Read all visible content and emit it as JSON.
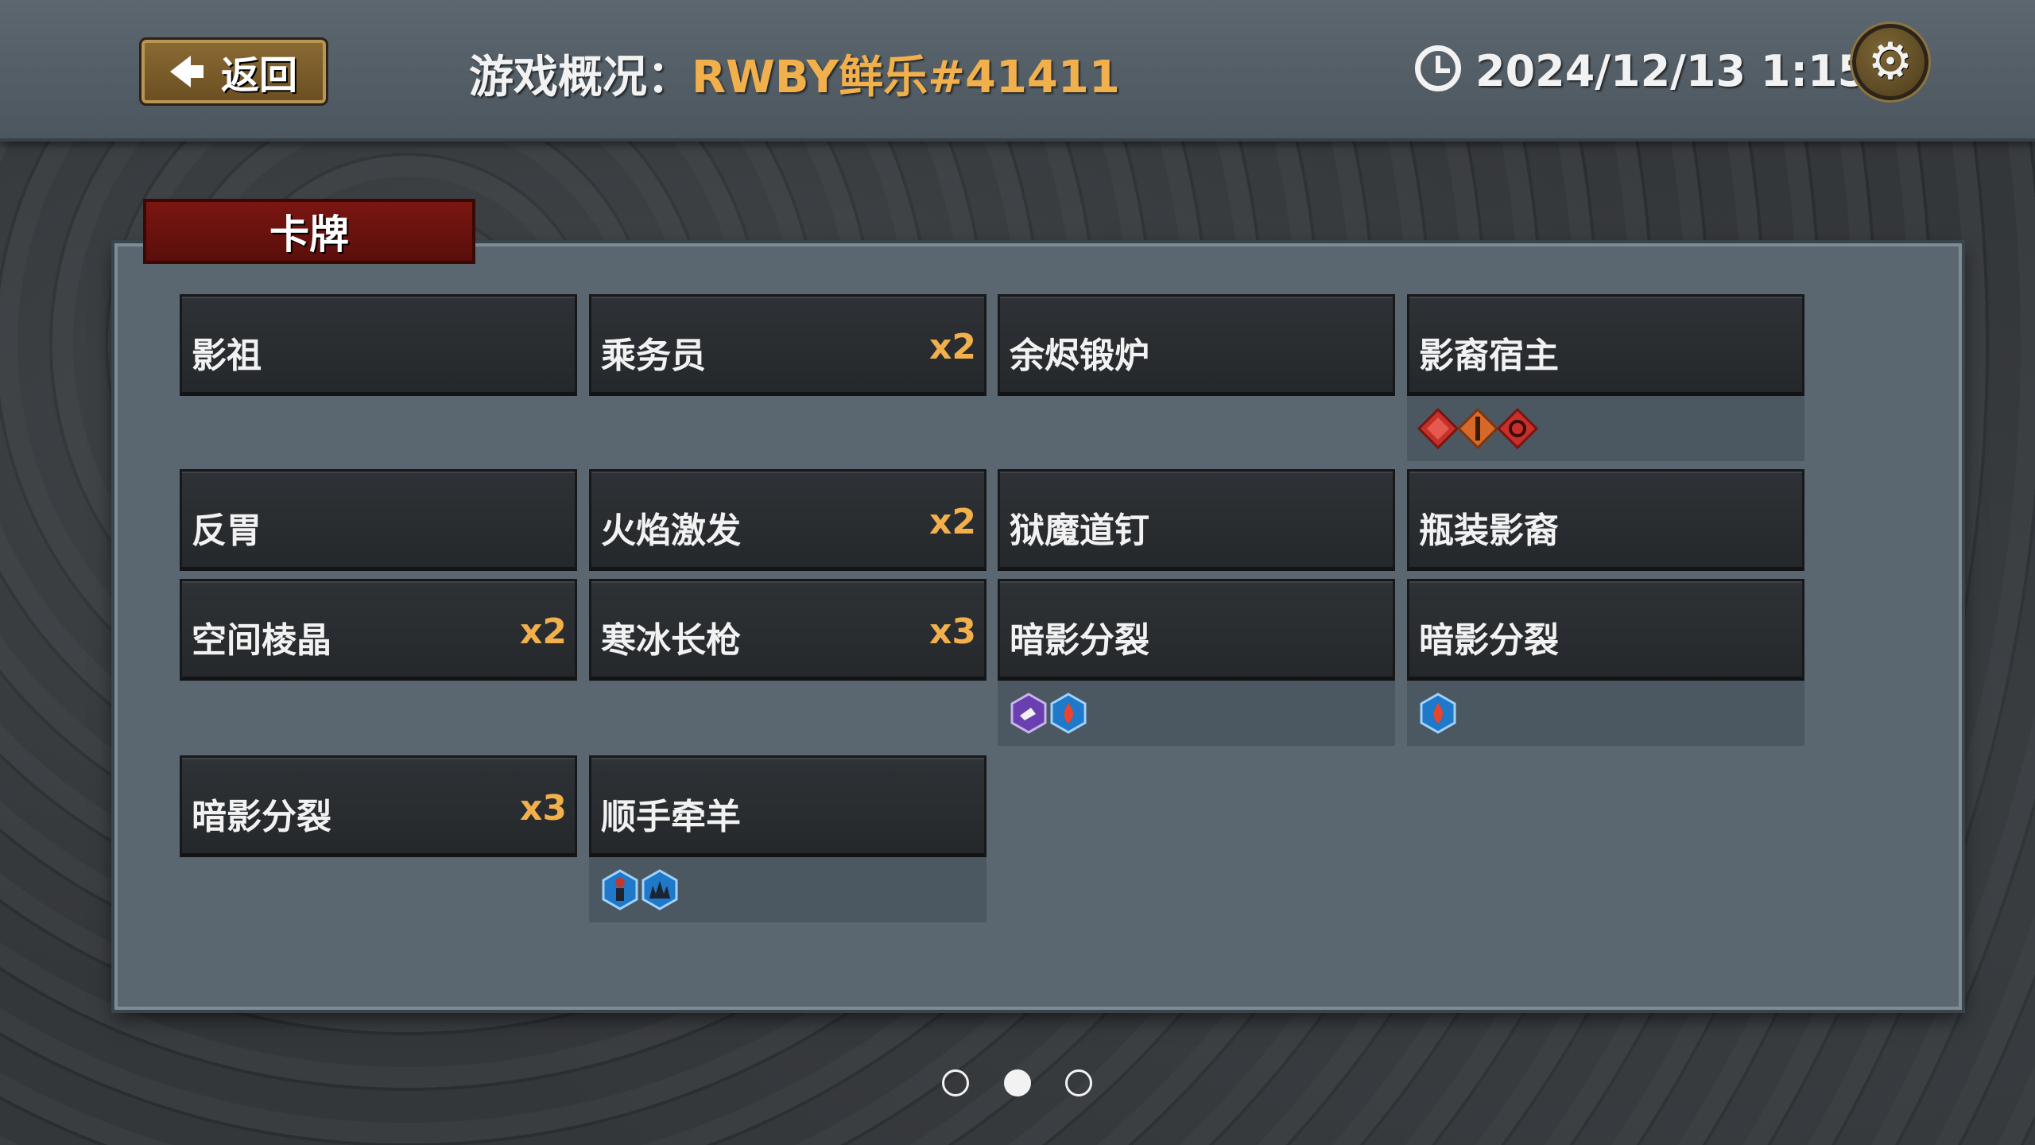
{
  "header": {
    "back_label": "返回",
    "title_prefix": "游戏概况：",
    "game_name": "RWBY鲜乐#41411",
    "datetime": "2024/12/13 1:15"
  },
  "section": {
    "title": "卡牌"
  },
  "cards": [
    {
      "name": "影祖",
      "count": ""
    },
    {
      "name": "乘务员",
      "count": "x2"
    },
    {
      "name": "余烬锻炉",
      "count": ""
    },
    {
      "name": "影裔宿主",
      "count": "",
      "icons": [
        "red-diamond-icon",
        "orange-diamond-icon",
        "red-swirl-diamond-icon"
      ]
    },
    {
      "name": "反胃",
      "count": ""
    },
    {
      "name": "火焰激发",
      "count": "x2"
    },
    {
      "name": "狱魔道钉",
      "count": ""
    },
    {
      "name": "瓶装影裔",
      "count": ""
    },
    {
      "name": "空间棱晶",
      "count": "x2"
    },
    {
      "name": "寒冰长枪",
      "count": "x3"
    },
    {
      "name": "暗影分裂",
      "count": "",
      "icons": [
        "purple-hex-icon",
        "blue-fire-hex-icon"
      ]
    },
    {
      "name": "暗影分裂",
      "count": "",
      "icons": [
        "blue-fire-hex-icon"
      ]
    },
    {
      "name": "暗影分裂",
      "count": "x3"
    },
    {
      "name": "顺手牵羊",
      "count": "",
      "icons": [
        "blue-figure-hex-icon",
        "blue-spiky-hex-icon"
      ]
    }
  ],
  "pagination": {
    "total": 3,
    "current": 2
  },
  "colors": {
    "accent_gold": "#f1b04c",
    "section_red": "#6a120f",
    "panel": "#5a6771",
    "card": "#2a2e31"
  }
}
